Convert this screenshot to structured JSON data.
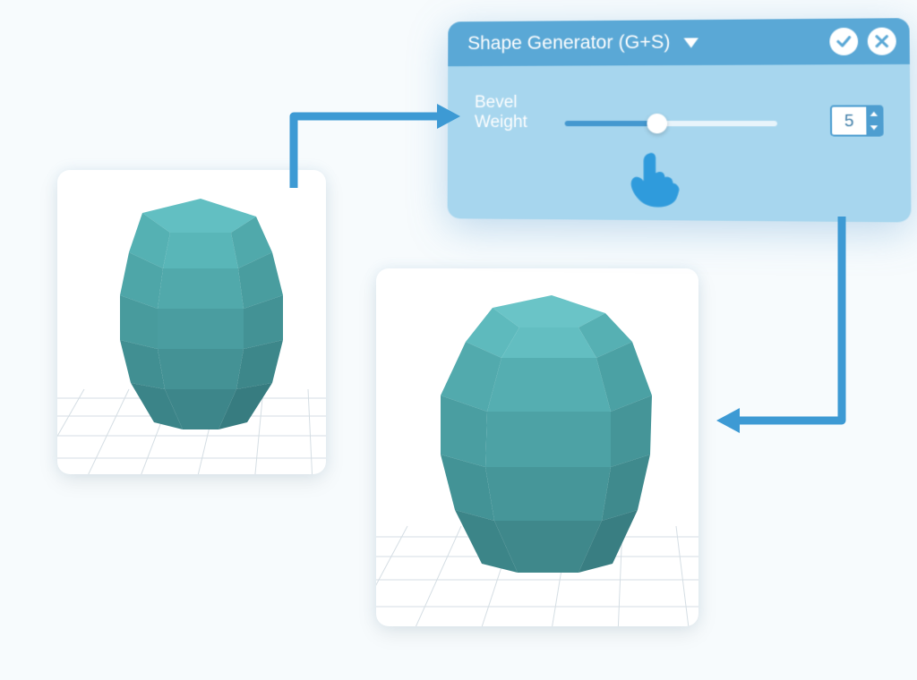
{
  "panel": {
    "title": "Shape Generator (G+S)",
    "confirm_icon": "check-icon",
    "close_icon": "close-icon",
    "dropdown_icon": "chevron-down-icon"
  },
  "param": {
    "label": "Bevel\nWeight",
    "value": "5",
    "slider_percent": 44
  },
  "previews": {
    "before_name": "shape-before",
    "after_name": "shape-after"
  },
  "colors": {
    "panel_header": "#5aa8d6",
    "panel_body": "#a7d6ee",
    "accent": "#3d9ad4",
    "shape_light": "#5bb8bb",
    "shape_dark": "#3f888d"
  }
}
